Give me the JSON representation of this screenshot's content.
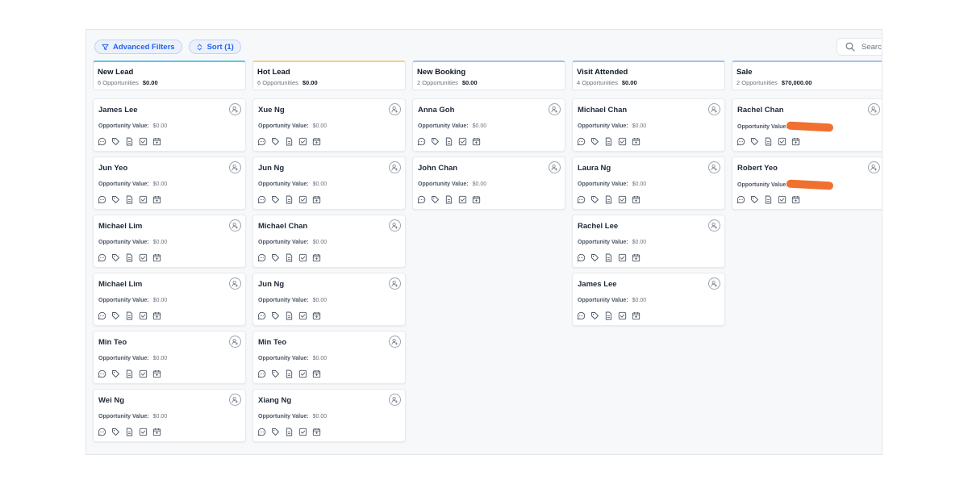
{
  "toolbar": {
    "advanced_filters_label": "Advanced Filters",
    "sort_label": "Sort (1)",
    "search_placeholder": "Search"
  },
  "opportunity_label": "Opportunity Value:",
  "colors": {
    "accent": "#2563eb",
    "column_top_border": {
      "new-lead": "#60c3ea",
      "hot-lead": "#f2d27a",
      "new-booking": "#9ec2ef",
      "visit-attended": "#9ec2ef",
      "sale": "#9ec2ef"
    },
    "redaction": "#f07030"
  },
  "card_action_icons": [
    "comment-icon",
    "tag-icon",
    "document-icon",
    "task-icon",
    "calendar-icon"
  ],
  "columns": [
    {
      "id": "new-lead",
      "title": "New Lead",
      "count": "6 Opportunities",
      "amount": "$0.00",
      "cards": [
        {
          "name": "James Lee",
          "value": "$0.00"
        },
        {
          "name": "Jun Yeo",
          "value": "$0.00"
        },
        {
          "name": "Michael Lim",
          "value": "$0.00"
        },
        {
          "name": "Michael Lim",
          "value": "$0.00"
        },
        {
          "name": "Min Teo",
          "value": "$0.00"
        },
        {
          "name": "Wei Ng",
          "value": "$0.00"
        }
      ]
    },
    {
      "id": "hot-lead",
      "title": "Hot Lead",
      "count": "6 Opportunities",
      "amount": "$0.00",
      "cards": [
        {
          "name": "Xue Ng",
          "value": "$0.00"
        },
        {
          "name": "Jun Ng",
          "value": "$0.00"
        },
        {
          "name": "Michael Chan",
          "value": "$0.00"
        },
        {
          "name": "Jun Ng",
          "value": "$0.00"
        },
        {
          "name": "Min Teo",
          "value": "$0.00"
        },
        {
          "name": "Xiang Ng",
          "value": "$0.00"
        }
      ]
    },
    {
      "id": "new-booking",
      "title": "New Booking",
      "count": "2 Opportunities",
      "amount": "$0.00",
      "cards": [
        {
          "name": "Anna Goh",
          "value": "$0.00"
        },
        {
          "name": "John Chan",
          "value": "$0.00"
        }
      ]
    },
    {
      "id": "visit-attended",
      "title": "Visit Attended",
      "count": "4 Opportunities",
      "amount": "$0.00",
      "cards": [
        {
          "name": "Michael Chan",
          "value": "$0.00"
        },
        {
          "name": "Laura Ng",
          "value": "$0.00"
        },
        {
          "name": "Rachel Lee",
          "value": "$0.00"
        },
        {
          "name": "James Lee",
          "value": "$0.00"
        }
      ]
    },
    {
      "id": "sale",
      "title": "Sale",
      "count": "2 Opportunities",
      "amount": "$70,000.00",
      "cards": [
        {
          "name": "Rachel Chan",
          "value": "",
          "redacted": true
        },
        {
          "name": "Robert Yeo",
          "value": "",
          "redacted": true
        }
      ]
    }
  ]
}
